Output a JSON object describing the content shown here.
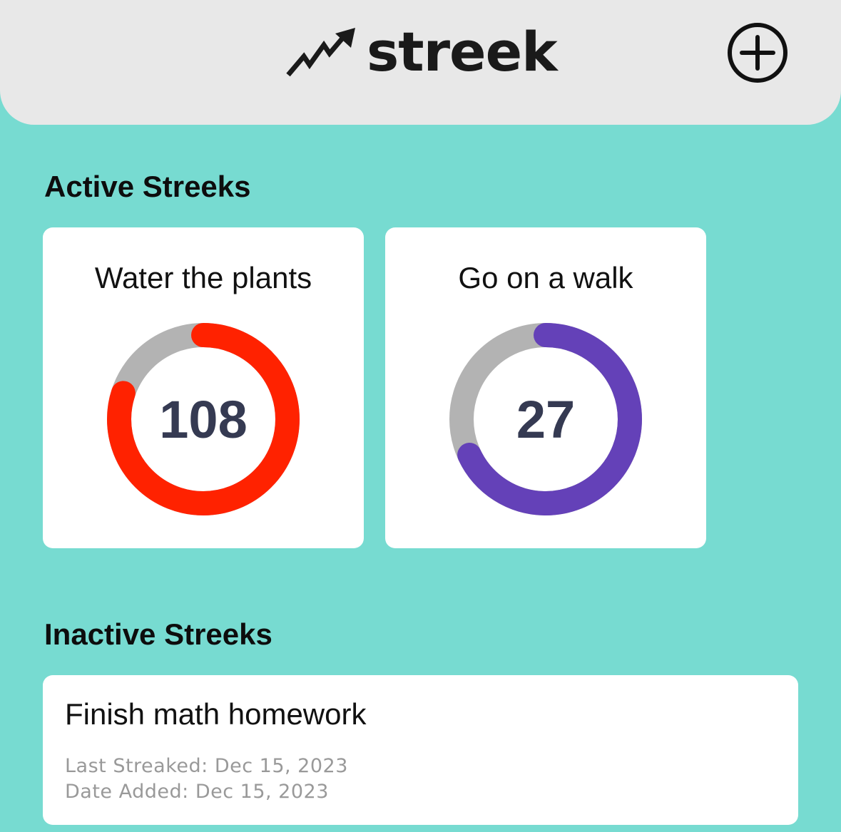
{
  "app": {
    "name": "streek",
    "logo_icon": "trending-arrow-icon",
    "add_icon": "plus-circle-icon"
  },
  "colors": {
    "background": "#77dbd1",
    "header": "#e8e8e8",
    "card": "#ffffff",
    "ring_track": "#b3b3b3",
    "count_text": "#353a52"
  },
  "active_section": {
    "heading": "Active Streeks",
    "streaks": [
      {
        "title": "Water the plants",
        "count": "108",
        "progress": 0.8,
        "color": "#ff2200"
      },
      {
        "title": "Go on a walk",
        "count": "27",
        "progress": 0.68,
        "color": "#6441b8"
      }
    ]
  },
  "inactive_section": {
    "heading": "Inactive Streeks",
    "streaks": [
      {
        "title": "Finish math homework",
        "last_streaked": "Last Streaked: Dec 15, 2023",
        "date_added": "Date Added: Dec 15, 2023"
      }
    ]
  }
}
